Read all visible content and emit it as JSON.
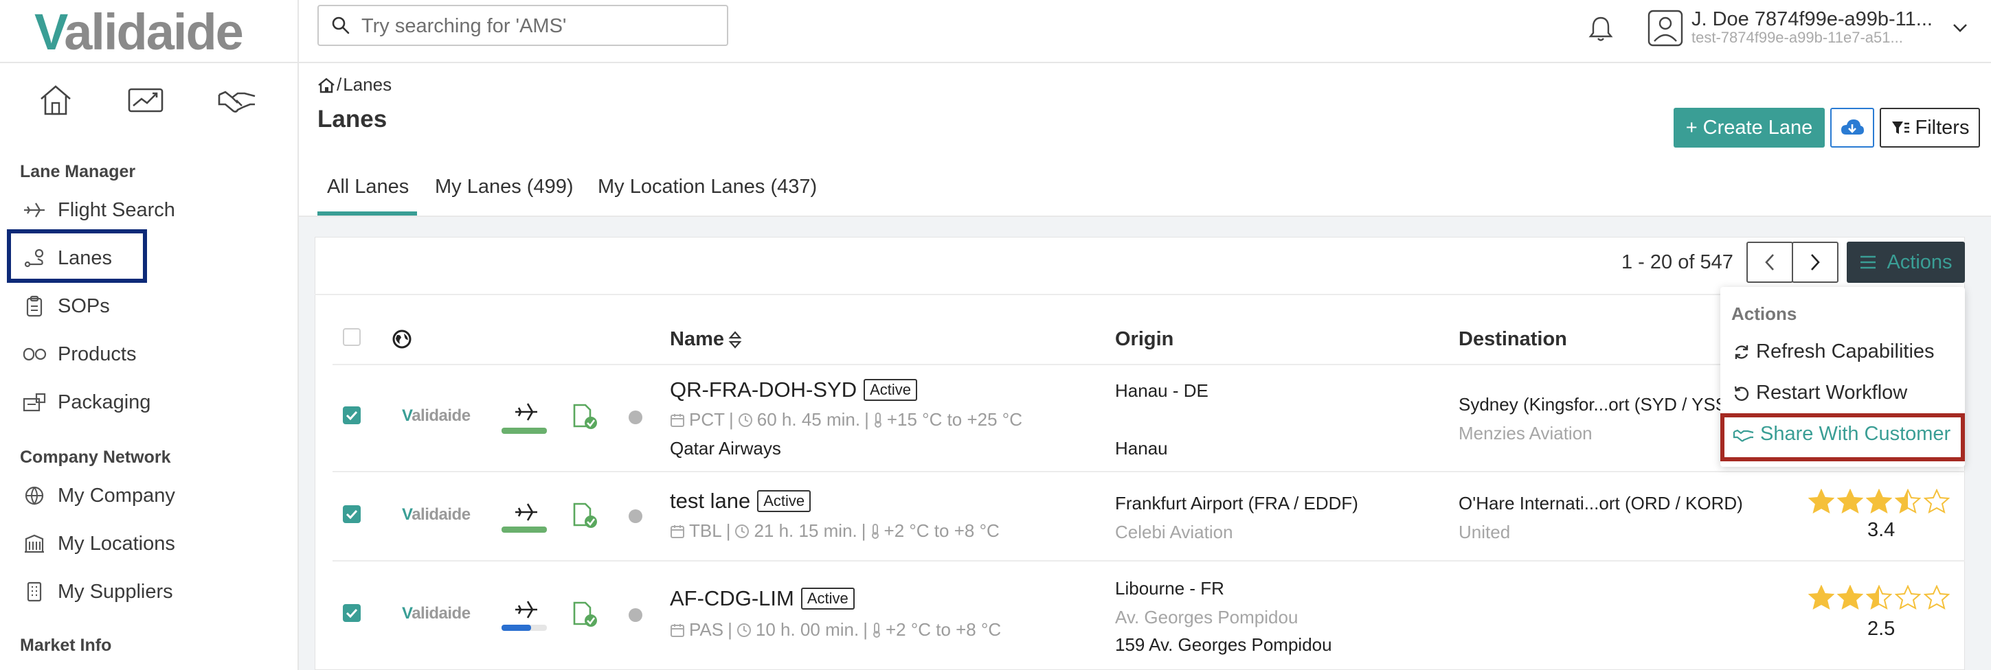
{
  "app": {
    "logo_text": "Validaide",
    "search_placeholder": "Try searching for 'AMS'"
  },
  "user": {
    "name": "J. Doe 7874f99e-a99b-11...",
    "email": "test-7874f99e-a99b-11e7-a51..."
  },
  "sidebar": {
    "sections": [
      {
        "title": "Lane Manager"
      },
      {
        "title": "Company Network"
      },
      {
        "title": "Market Info"
      }
    ],
    "items": [
      {
        "label": "Flight Search",
        "icon": "plane-search-icon"
      },
      {
        "label": "Lanes",
        "icon": "route-icon"
      },
      {
        "label": "SOPs",
        "icon": "clipboard-icon"
      },
      {
        "label": "Products",
        "icon": "products-icon"
      },
      {
        "label": "Packaging",
        "icon": "packaging-icon"
      },
      {
        "label": "My Company",
        "icon": "globe-icon"
      },
      {
        "label": "My Locations",
        "icon": "building-icon"
      },
      {
        "label": "My Suppliers",
        "icon": "supplier-icon"
      }
    ]
  },
  "breadcrumb": {
    "current": "Lanes"
  },
  "page": {
    "title": "Lanes"
  },
  "toolbar": {
    "create_label": "+ Create Lane",
    "filters_label": "Filters"
  },
  "tabs": [
    {
      "label": "All Lanes",
      "active": true
    },
    {
      "label": "My Lanes (499)",
      "active": false
    },
    {
      "label": "My Location Lanes (437)",
      "active": false
    }
  ],
  "pagination": {
    "text": "1 - 20 of 547"
  },
  "actions": {
    "button_label": "Actions",
    "menu_header": "Actions",
    "items": [
      {
        "label": "Refresh Capabilities",
        "icon": "refresh-icon"
      },
      {
        "label": "Restart Workflow",
        "icon": "restart-icon"
      },
      {
        "label": "Share With Customer",
        "icon": "handshake-icon",
        "highlighted": true
      }
    ]
  },
  "table": {
    "columns": {
      "name": "Name",
      "origin": "Origin",
      "destination": "Destination"
    },
    "rows": [
      {
        "checked": true,
        "logo": "Validaide",
        "bar_color": "#6ab06d",
        "bar_fill": 1.0,
        "name": "QR-FRA-DOH-SYD",
        "status": "Active",
        "packaging": "PCT",
        "duration": "60 h. 45 min.",
        "temperature": "+15 °C to +25 °C",
        "carrier": "Qatar Airways",
        "origin_line1": "Hanau - DE",
        "origin_line2": "",
        "origin_line3": "Hanau",
        "destination_line1": "Sydney (Kingsfor...ort (SYD / YSSY)",
        "destination_line2": "Menzies Aviation",
        "rating": ""
      },
      {
        "checked": true,
        "logo": "Validaide",
        "bar_color": "#6ab06d",
        "bar_fill": 1.0,
        "name": "test lane",
        "status": "Active",
        "packaging": "TBL",
        "duration": "21 h. 15 min.",
        "temperature": "+2 °C to +8 °C",
        "carrier": "",
        "origin_line1": "Frankfurt Airport (FRA / EDDF)",
        "origin_line2": "Celebi Aviation",
        "origin_line3": "",
        "destination_line1": "O'Hare Internati...ort (ORD / KORD)",
        "destination_line2": "United",
        "rating": "3.4",
        "rating_value": 3.4
      },
      {
        "checked": true,
        "logo": "Validaide",
        "bar_color": "#2a6fd0",
        "bar_fill": 0.65,
        "name": "AF-CDG-LIM",
        "status": "Active",
        "packaging": "PAS",
        "duration": "10 h. 00 min.",
        "temperature": "+2 °C to +8 °C",
        "carrier": "",
        "origin_line1": "Libourne - FR",
        "origin_line2": "Av. Georges Pompidou",
        "origin_line3": "159 Av. Georges Pompidou",
        "destination_line1": "",
        "destination_line2": "",
        "rating": "2.5",
        "rating_value": 2.5
      }
    ]
  },
  "colors": {
    "brand": "#3a9e95",
    "sidebar_highlight": "#0d2a78",
    "menu_highlight": "#a52a22",
    "star": "#f5c03a"
  }
}
